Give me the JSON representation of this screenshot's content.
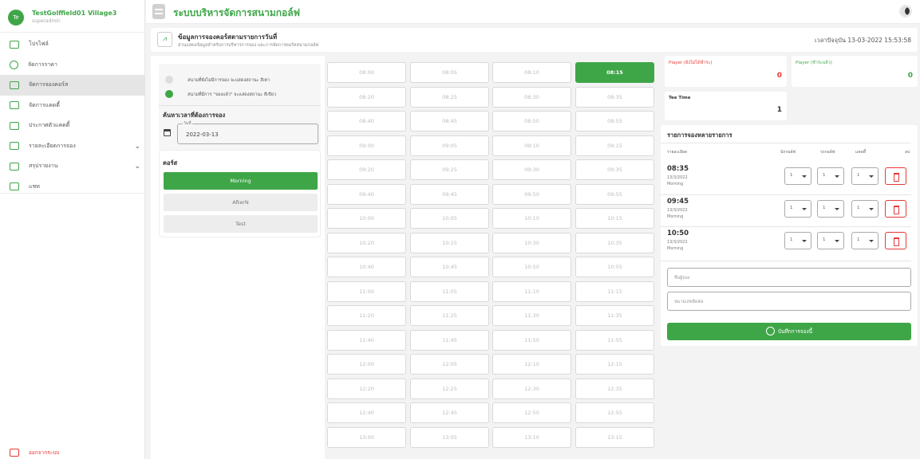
{
  "user": {
    "initials": "Te",
    "name": "TestGolffield01 Village3",
    "role": "superadmin"
  },
  "nav": [
    {
      "label": "โปรไฟล์",
      "icon": "profile-icon"
    },
    {
      "label": "จัดการราคา",
      "icon": "price-icon"
    },
    {
      "label": "จัดการจองคอร์ส",
      "icon": "chart-icon",
      "active": true
    },
    {
      "label": "จัดการแคดดี้",
      "icon": "caddie-icon"
    },
    {
      "label": "ประกาศตัวแคดดี้",
      "icon": "announce-icon"
    },
    {
      "label": "รายละเอียดการจอง",
      "icon": "list-icon",
      "expandable": true
    },
    {
      "label": "สรุปรายงาน",
      "icon": "report-icon",
      "expandable": true
    },
    {
      "label": "แชท",
      "icon": "chat-icon"
    }
  ],
  "logout_label": "ออกจากระบบ",
  "app_title": "ระบบบริหารจัดการสนามกอล์ฟ",
  "header": {
    "title": "ข้อมูลการจองคอร์สตามรายการวันที่",
    "subtitle": "ส่วนแสดงข้อมูลสำหรับการบริหารการจอง และการจัดการคอร์สสนามกอล์ฟ",
    "time": "เวลาปัจจุบัน 13-03-2022 15:53:58"
  },
  "legend": {
    "available": "สนามที่ยังไม่มีการจอง จะแสดงสถานะ สีเทา",
    "booked": "สนามที่มีการ \"จองแล้ว\" จะแสดงสถานะ สีเขียว"
  },
  "search": {
    "label": "ค้นหาเวลาที่ต้องการจอง",
    "date_legend": "วันที่",
    "date_value": "2022-03-13"
  },
  "course": {
    "title": "คอร์ส",
    "options": [
      "Morning",
      "AfterN",
      "Test"
    ],
    "selected": "Morning"
  },
  "slots": [
    "08:00",
    "08:05",
    "08:10",
    "08:15",
    "08:20",
    "08:25",
    "08:30",
    "08:35",
    "08:40",
    "08:45",
    "08:50",
    "08:55",
    "09:00",
    "09:05",
    "09:10",
    "09:15",
    "09:20",
    "09:25",
    "09:30",
    "09:35",
    "09:40",
    "09:45",
    "09:50",
    "09:55",
    "10:00",
    "10:05",
    "10:10",
    "10:15",
    "10:20",
    "10:25",
    "10:30",
    "10:35",
    "10:40",
    "10:45",
    "10:50",
    "10:55",
    "11:00",
    "11:05",
    "11:10",
    "11:15",
    "11:20",
    "11:25",
    "11:30",
    "11:35",
    "11:40",
    "11:45",
    "11:50",
    "11:55",
    "12:00",
    "12:05",
    "12:10",
    "12:15",
    "12:20",
    "12:25",
    "12:30",
    "12:35",
    "12:40",
    "12:45",
    "12:50",
    "12:55",
    "13:00",
    "13:05",
    "13:10",
    "13:15"
  ],
  "selected_slot": "08:15",
  "stats": {
    "player_unpaid": {
      "label": "Player (ยังไม่ได้ชำระ)",
      "value": "0"
    },
    "player_paid": {
      "label": "Player (ชำระแล้ว)",
      "value": "0"
    },
    "tee_time": {
      "label": "Tee Time",
      "value": "1"
    }
  },
  "reservations": {
    "title": "รายการจองหลายรายการ",
    "headers": [
      "รายละเอียด",
      "นักกอล์ฟ",
      "รถกอล์ฟ",
      "แคดดี้",
      "ลบ"
    ],
    "rows": [
      {
        "time": "08:35",
        "date": "13/3/2022",
        "course": "Morning",
        "golfer": "1",
        "cart": "1",
        "caddie": "1"
      },
      {
        "time": "09:45",
        "date": "13/3/2022",
        "course": "Morning",
        "golfer": "1",
        "cart": "1",
        "caddie": "1"
      },
      {
        "time": "10:50",
        "date": "13/3/2022",
        "course": "Morning",
        "golfer": "1",
        "cart": "1",
        "caddie": "1"
      }
    ],
    "name_placeholder": "ชื่อผู้จอง",
    "phone_placeholder": "หมายเลขติดต่อ",
    "save_label": "บันทึกการจองนี้"
  },
  "colors": {
    "brand": "#3fa648",
    "danger": "#e53935"
  }
}
